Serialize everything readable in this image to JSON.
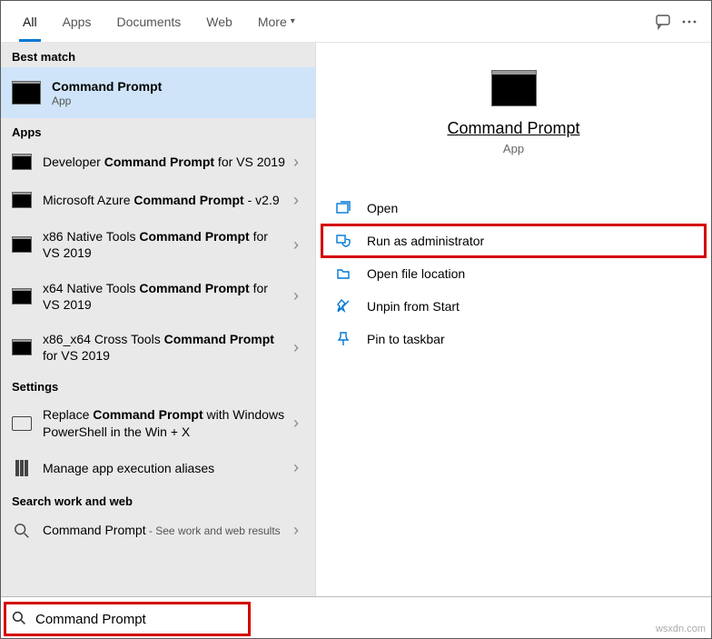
{
  "tabs": {
    "all": "All",
    "apps": "Apps",
    "documents": "Documents",
    "web": "Web",
    "more": "More"
  },
  "sections": {
    "best_match": "Best match",
    "apps": "Apps",
    "settings": "Settings",
    "search_work_web": "Search work and web"
  },
  "best_match_item": {
    "title": "Command Prompt",
    "sub": "App"
  },
  "apps_items": [
    {
      "prefix": "Developer ",
      "bold": "Command Prompt",
      "suffix": " for VS 2019"
    },
    {
      "prefix": "Microsoft Azure ",
      "bold": "Command Prompt",
      "suffix": " - v2.9"
    },
    {
      "prefix": "x86 Native Tools ",
      "bold": "Command Prompt",
      "suffix": " for VS 2019"
    },
    {
      "prefix": "x64 Native Tools ",
      "bold": "Command Prompt",
      "suffix": " for VS 2019"
    },
    {
      "prefix": "x86_x64 Cross Tools ",
      "bold": "Command Prompt",
      "suffix": " for VS 2019"
    }
  ],
  "settings_items": [
    {
      "prefix": "Replace ",
      "bold": "Command Prompt",
      "suffix": " with Windows PowerShell in the Win + X"
    },
    {
      "prefix": "Manage app execution aliases",
      "bold": "",
      "suffix": ""
    }
  ],
  "web_items": [
    {
      "title": "Command Prompt",
      "hint": " - See work and web results"
    }
  ],
  "preview": {
    "title": "Command Prompt",
    "sub": "App"
  },
  "actions": {
    "open": "Open",
    "run_admin": "Run as administrator",
    "open_loc": "Open file location",
    "unpin_start": "Unpin from Start",
    "pin_taskbar": "Pin to taskbar"
  },
  "search": {
    "value": "Command Prompt"
  },
  "watermark": "wsxdn.com"
}
